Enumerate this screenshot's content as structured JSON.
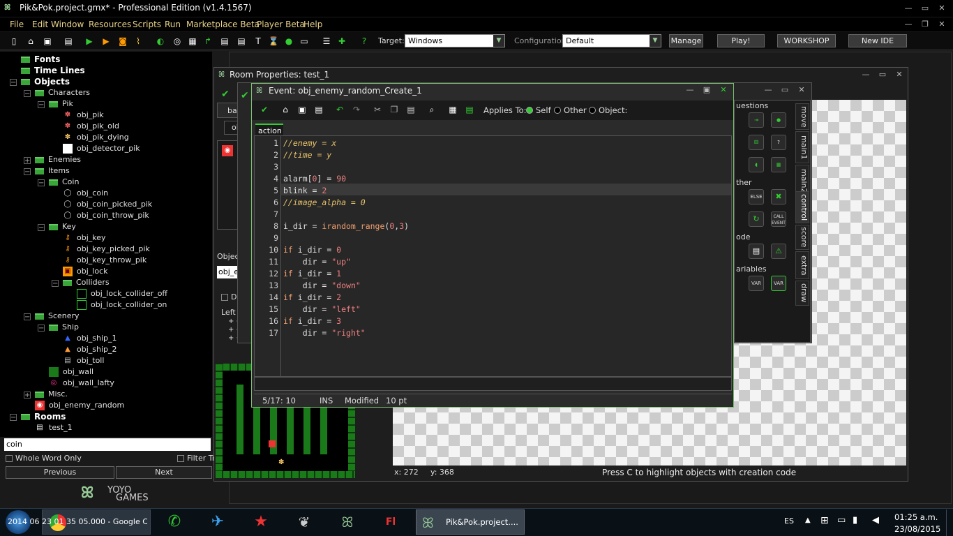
{
  "window": {
    "title": "Pik&Pok.project.gmx* - Professional Edition (v1.4.1567)"
  },
  "menu": [
    "File",
    "Edit",
    "Window",
    "Resources",
    "Scripts",
    "Run",
    "Marketplace Beta",
    "Player Beta",
    "Help"
  ],
  "toolbar": {
    "target_label": "Target:",
    "target_value": "Windows",
    "config_label": "Configuration:",
    "config_value": "Default",
    "manage": "Manage",
    "play": "Play!",
    "workshop": "WORKSHOP",
    "new_ide": "New IDE"
  },
  "tree": {
    "fonts": "Fonts",
    "timelines": "Time Lines",
    "objects": "Objects",
    "characters": "Characters",
    "pik": "Pik",
    "obj_pik": "obj_pik",
    "obj_pik_old": "obj_pik_old",
    "obj_pik_dying": "obj_pik_dying",
    "obj_detector_pik": "obj_detector_pik",
    "enemies": "Enemies",
    "items": "Items",
    "coin": "Coin",
    "obj_coin": "obj_coin",
    "obj_coin_picked_pik": "obj_coin_picked_pik",
    "obj_coin_throw_pik": "obj_coin_throw_pik",
    "key": "Key",
    "obj_key": "obj_key",
    "obj_key_picked_pik": "obj_key_picked_pik",
    "obj_key_throw_pik": "obj_key_throw_pik",
    "obj_lock": "obj_lock",
    "colliders": "Colliders",
    "obj_lock_collider_off": "obj_lock_collider_off",
    "obj_lock_collider_on": "obj_lock_collider_on",
    "scenery": "Scenery",
    "ship": "Ship",
    "obj_ship_1": "obj_ship_1",
    "obj_ship_2": "obj_ship_2",
    "obj_toll": "obj_toll",
    "obj_wall": "obj_wall",
    "obj_wall_lafty": "obj_wall_lafty",
    "misc": "Misc.",
    "obj_enemy_random": "obj_enemy_random",
    "rooms": "Rooms",
    "test_1": "test_1"
  },
  "search": {
    "value": "coin",
    "whole_word": "Whole Word Only",
    "filter": "Filter Tr",
    "previous": "Previous",
    "next": "Next"
  },
  "logo": {
    "yoyo": "YOYO",
    "games": "GAMES"
  },
  "room": {
    "title": "Room Properties: test_1",
    "tab_backgrounds": "backgr",
    "tab_objects": "object",
    "object_to_add": "Object to a",
    "object_field": "obj_enemy",
    "delete_label": "Delet",
    "left_mouse": "Left mous",
    "hint1": "+ <Alt>",
    "hint2": "+ <Shif",
    "hint3": "+ <Shif",
    "coords_x": "x: 272",
    "coords_y": "y: 368",
    "status": "Press C to highlight objects with creation code"
  },
  "actions_panel": {
    "questions": "uestions",
    "other": "ther",
    "code": "ode",
    "variables": "ariables",
    "tabs": [
      "move",
      "main1",
      "main2",
      "control",
      "score",
      "extra",
      "draw"
    ],
    "else": "ELSE",
    "call_event": "CALL EVENT",
    "var": "VAR"
  },
  "event": {
    "title": "Event: obj_enemy_random_Create_1",
    "applies_to": "Applies To:",
    "self": "Self",
    "other": "Other",
    "object": "Object:",
    "tab_action": "action",
    "status": {
      "pos": "5/17: 10",
      "mode": "INS",
      "modified": "Modified",
      "size": "10 pt"
    }
  },
  "code_lines": [
    "//enemy = x",
    "//time = y",
    "",
    "alarm[0] = 90",
    "blink = 2",
    "//image_alpha = 0",
    "",
    "i_dir = irandom_range(0,3)",
    "",
    "if i_dir = 0",
    "    dir = \"up\"",
    "if i_dir = 1",
    "    dir = \"down\"",
    "if i_dir = 2",
    "    dir = \"left\"",
    "if i_dir = 3",
    "    dir = \"right\""
  ],
  "taskbar": {
    "chrome_title": "2014 06 23 01 35 05.000 - Google C...",
    "gm_title": "Pik&Pok.project....",
    "lang": "ES",
    "time": "01:25 a.m.",
    "date": "23/08/2015"
  }
}
